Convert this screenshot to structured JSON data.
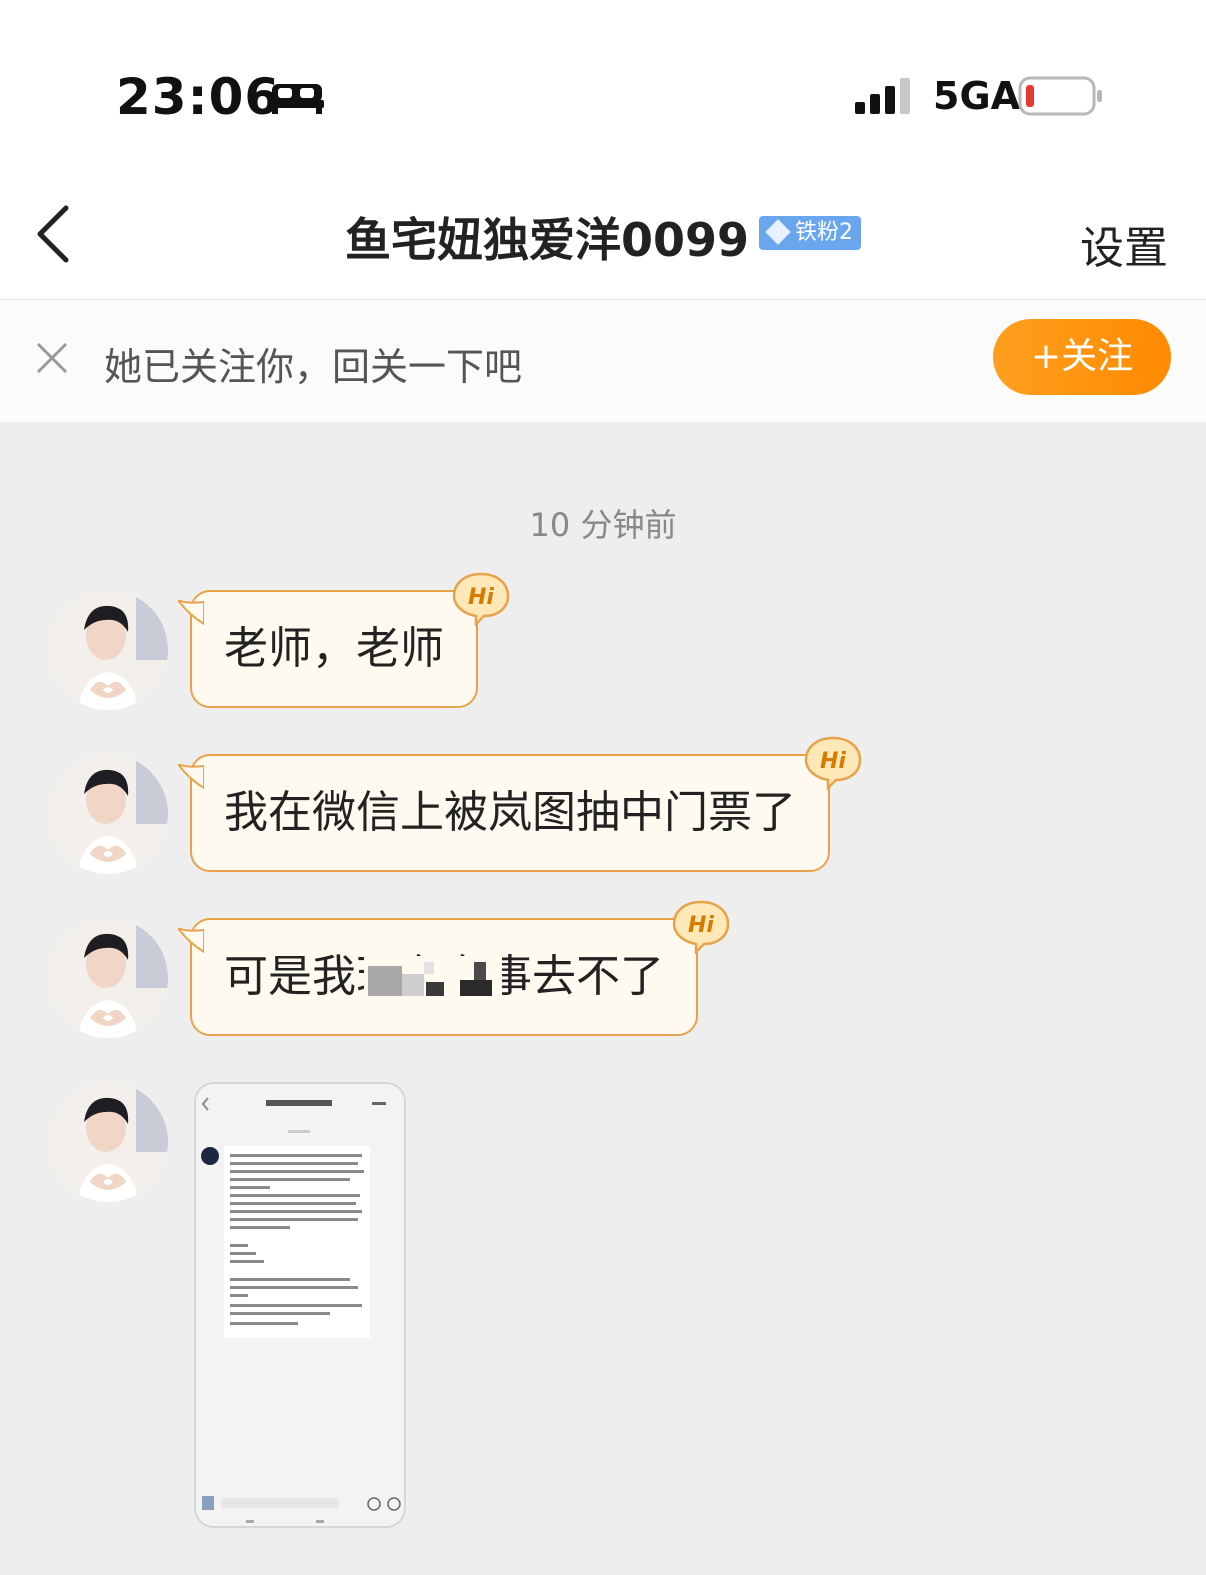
{
  "status_bar": {
    "time": "23:06",
    "network": "5GA",
    "icons": [
      "bed-icon",
      "signal-icon",
      "battery-icon"
    ],
    "battery_color": "#e53935"
  },
  "nav": {
    "back_icon": "chevron-left-icon",
    "title": "鱼宅妞独爱洋0099",
    "badge": "铁粉2",
    "settings_label": "设置"
  },
  "follow_banner": {
    "text": "她已关注你，回关一下吧",
    "button_label": "+关注",
    "accent": "#ff8f00"
  },
  "chat": {
    "timestamp": "10 分钟前",
    "hi_badge": "Hi",
    "messages": [
      {
        "type": "text",
        "text": "老师，老师"
      },
      {
        "type": "text",
        "text": "我在微信上被岚图抽中门票了"
      },
      {
        "type": "text",
        "text": "可是我现在有事去不了",
        "note": "partially pixelated"
      },
      {
        "type": "image",
        "description": "screenshot of a chat"
      }
    ]
  }
}
